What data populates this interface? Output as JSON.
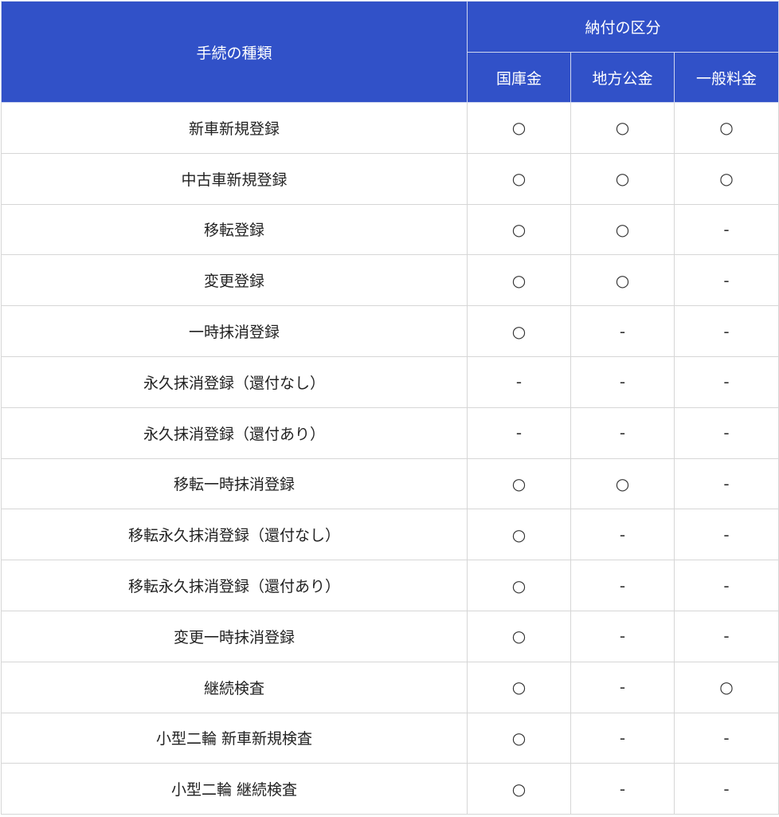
{
  "table": {
    "header": {
      "procedure_type": "手続の種類",
      "payment_category": "納付の区分",
      "columns": [
        "国庫金",
        "地方公金",
        "一般料金"
      ]
    },
    "rows": [
      {
        "name": "新車新規登録",
        "values": [
          "○",
          "○",
          "○"
        ]
      },
      {
        "name": "中古車新規登録",
        "values": [
          "○",
          "○",
          "○"
        ]
      },
      {
        "name": "移転登録",
        "values": [
          "○",
          "○",
          "-"
        ]
      },
      {
        "name": "変更登録",
        "values": [
          "○",
          "○",
          "-"
        ]
      },
      {
        "name": "一時抹消登録",
        "values": [
          "○",
          "-",
          "-"
        ]
      },
      {
        "name": "永久抹消登録（還付なし）",
        "values": [
          "-",
          "-",
          "-"
        ]
      },
      {
        "name": "永久抹消登録（還付あり）",
        "values": [
          "-",
          "-",
          "-"
        ]
      },
      {
        "name": "移転一時抹消登録",
        "values": [
          "○",
          "○",
          "-"
        ]
      },
      {
        "name": "移転永久抹消登録（還付なし）",
        "values": [
          "○",
          "-",
          "-"
        ]
      },
      {
        "name": "移転永久抹消登録（還付あり）",
        "values": [
          "○",
          "-",
          "-"
        ]
      },
      {
        "name": "変更一時抹消登録",
        "values": [
          "○",
          "-",
          "-"
        ]
      },
      {
        "name": "継続検査",
        "values": [
          "○",
          "-",
          "○"
        ]
      },
      {
        "name": "小型二輪 新車新規検査",
        "values": [
          "○",
          "-",
          "-"
        ]
      },
      {
        "name": "小型二輪 継続検査",
        "values": [
          "○",
          "-",
          "-"
        ]
      }
    ]
  },
  "colors": {
    "header_background": "#3151c8",
    "header_text": "#ffffff",
    "grid_line": "#d6d6d6"
  }
}
